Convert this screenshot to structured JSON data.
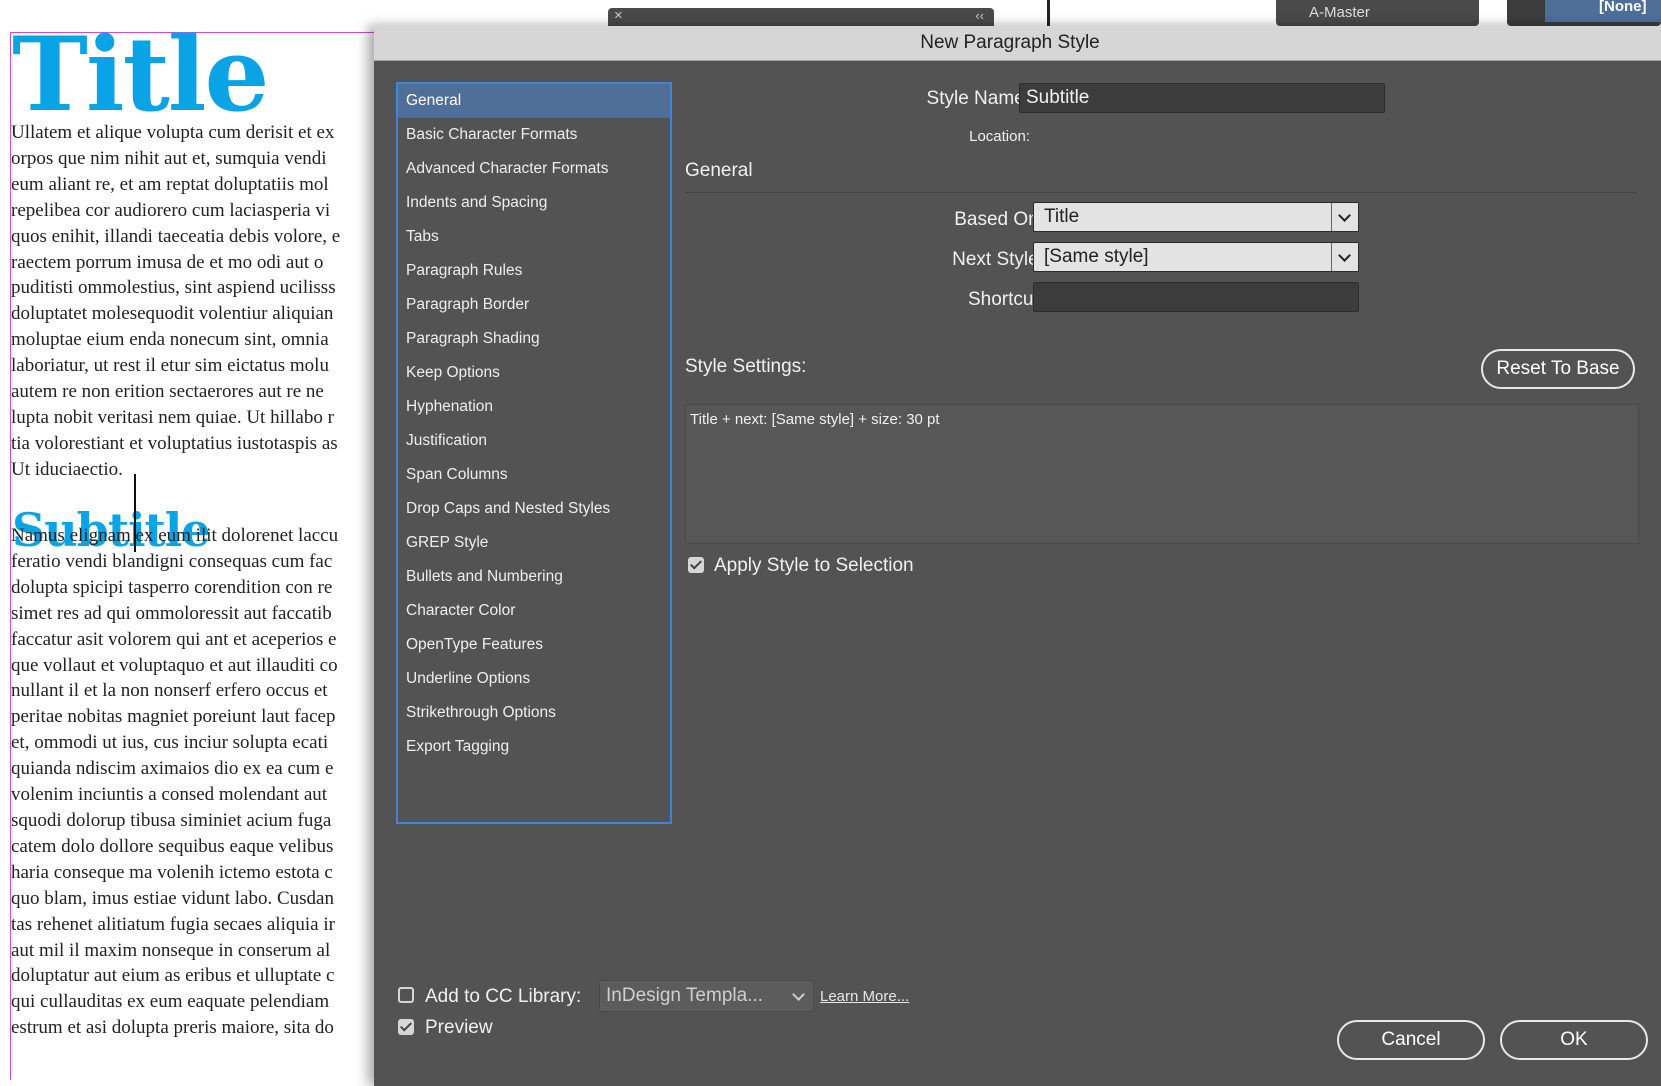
{
  "document": {
    "title": "Title",
    "subtitle": "Subtitle",
    "body_paragraph_1": "Ullatem et alique volupta cum derisit et ex\norpos que nim nihit aut et, sumquia vendi\neum aliant re, et am reptat doluptatiis mol\nrepelibea cor audiorero cum laciasperia vi\nquos enihit, illandi taeceatia debis volore, e\nraectem porrum imusa de et mo odi aut o\npuditisti ommolestius, sint aspiend ucilisss\ndoluptatet molesequodit volentiur aliquian\nmoluptae eium enda nonecum sint, omnia\nlaboriatur, ut rest il etur sim eictatus molu\nautem re non erition sectaerores aut re ne\nlupta nobit veritasi nem quiae. Ut hillabo r\ntia volorestiant et voluptatius iustotaspis as\nUt iduciaectio.",
    "body_paragraph_2": "Namus elignam ex eum ilit dolorenet laccu\nferatio vendi blandigni consequas cum fac\ndolupta spicipi tasperro corendition con re\nsimet res ad qui ommoloressit aut faccatib\nfaccatur asit volorem qui ant et aceperios e\nque vollaut et voluptaquo et aut illauditi co\nnullant il et la non nonserf erfero occus et\nperitae nobitas magniet poreiunt laut facep\net, ommodi ut ius, cus inciur solupta ecati\nquianda ndiscim aximaios dio ex ea cum e\nvolenim inciuntis a consed molendant aut\nsquodi dolorup tibusa siminiet acium fuga\ncatem dolo dollore sequibus eaque velibus\nharia conseque ma volenih ictemo estota c\nquo blam, imus estiae vidunt labo. Cusdan\ntas rehenet alitiatum fugia secaes aliquia ir\naut mil il maxim nonseque in conserum al\ndoluptatur aut eium as eribus et ulluptate c\nqui cullauditas ex eum eaquate pelendiam\nestrum et asi dolupta preris maiore, sita do"
  },
  "top_panels": {
    "master_label": "A-Master",
    "none_label": "[None]",
    "collapse_glyph": "‹‹",
    "close_glyph": "×"
  },
  "dialog": {
    "title": "New Paragraph Style",
    "categories": [
      {
        "label": "General",
        "selected": true
      },
      {
        "label": "Basic Character Formats"
      },
      {
        "label": "Advanced Character Formats"
      },
      {
        "label": "Indents and Spacing"
      },
      {
        "label": "Tabs"
      },
      {
        "label": "Paragraph Rules"
      },
      {
        "label": "Paragraph Border"
      },
      {
        "label": "Paragraph Shading"
      },
      {
        "label": "Keep Options"
      },
      {
        "label": "Hyphenation"
      },
      {
        "label": "Justification"
      },
      {
        "label": "Span Columns"
      },
      {
        "label": "Drop Caps and Nested Styles"
      },
      {
        "label": "GREP Style"
      },
      {
        "label": "Bullets and Numbering"
      },
      {
        "label": "Character Color"
      },
      {
        "label": "OpenType Features"
      },
      {
        "label": "Underline Options"
      },
      {
        "label": "Strikethrough Options"
      },
      {
        "label": "Export Tagging"
      }
    ],
    "style_name_label": "Style Name:",
    "style_name_value": "Subtitle",
    "location_label": "Location:",
    "section_heading": "General",
    "based_on_label": "Based On:",
    "based_on_value": "Title",
    "next_style_label": "Next Style:",
    "next_style_value": "[Same style]",
    "shortcut_label": "Shortcut:",
    "shortcut_value": "",
    "style_settings_label": "Style Settings:",
    "reset_button": "Reset To Base",
    "style_settings_text": "Title + next: [Same style] + size: 30 pt",
    "apply_style_label": "Apply Style to Selection",
    "apply_style_checked": true,
    "cc_library_label": "Add to CC Library:",
    "cc_library_checked": false,
    "cc_library_value": "InDesign Templa...",
    "learn_more": "Learn More...",
    "preview_label": "Preview",
    "preview_checked": true,
    "cancel_button": "Cancel",
    "ok_button": "OK"
  }
}
